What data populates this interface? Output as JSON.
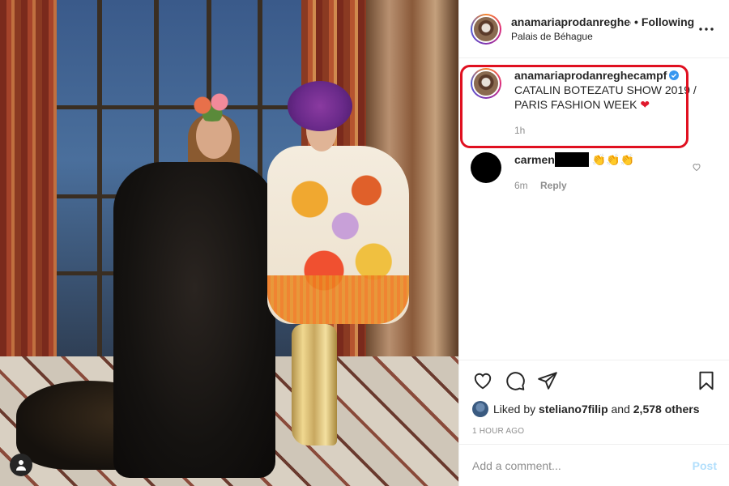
{
  "post": {
    "username": "anamariaprodanreghecampf",
    "username_header": "anamariaprodanreghec",
    "follow_state": "Following",
    "location": "Palais de Béhague",
    "more_icon": "more-horizontal-icon"
  },
  "caption": {
    "username": "anamariaprodanreghecampf",
    "verified": true,
    "line1": "CATALIN BOTEZATU SHOW 2019 /",
    "line2": "PARIS FASHION WEEK",
    "emoji": "❤",
    "time": "1h"
  },
  "comment": {
    "username": "carmen",
    "text": "👏👏👏",
    "time": "6m",
    "reply_label": "Reply"
  },
  "likes": {
    "prefix": "Liked by",
    "user": "steliano7filip",
    "joiner": "and",
    "others": "2,578 others"
  },
  "time_ago": "1 HOUR AGO",
  "comment_box": {
    "placeholder": "Add a comment...",
    "post_label": "Post"
  },
  "colors": {
    "highlight": "#e01020",
    "post_button": "#b2dffc",
    "verified": "#3897f0"
  }
}
